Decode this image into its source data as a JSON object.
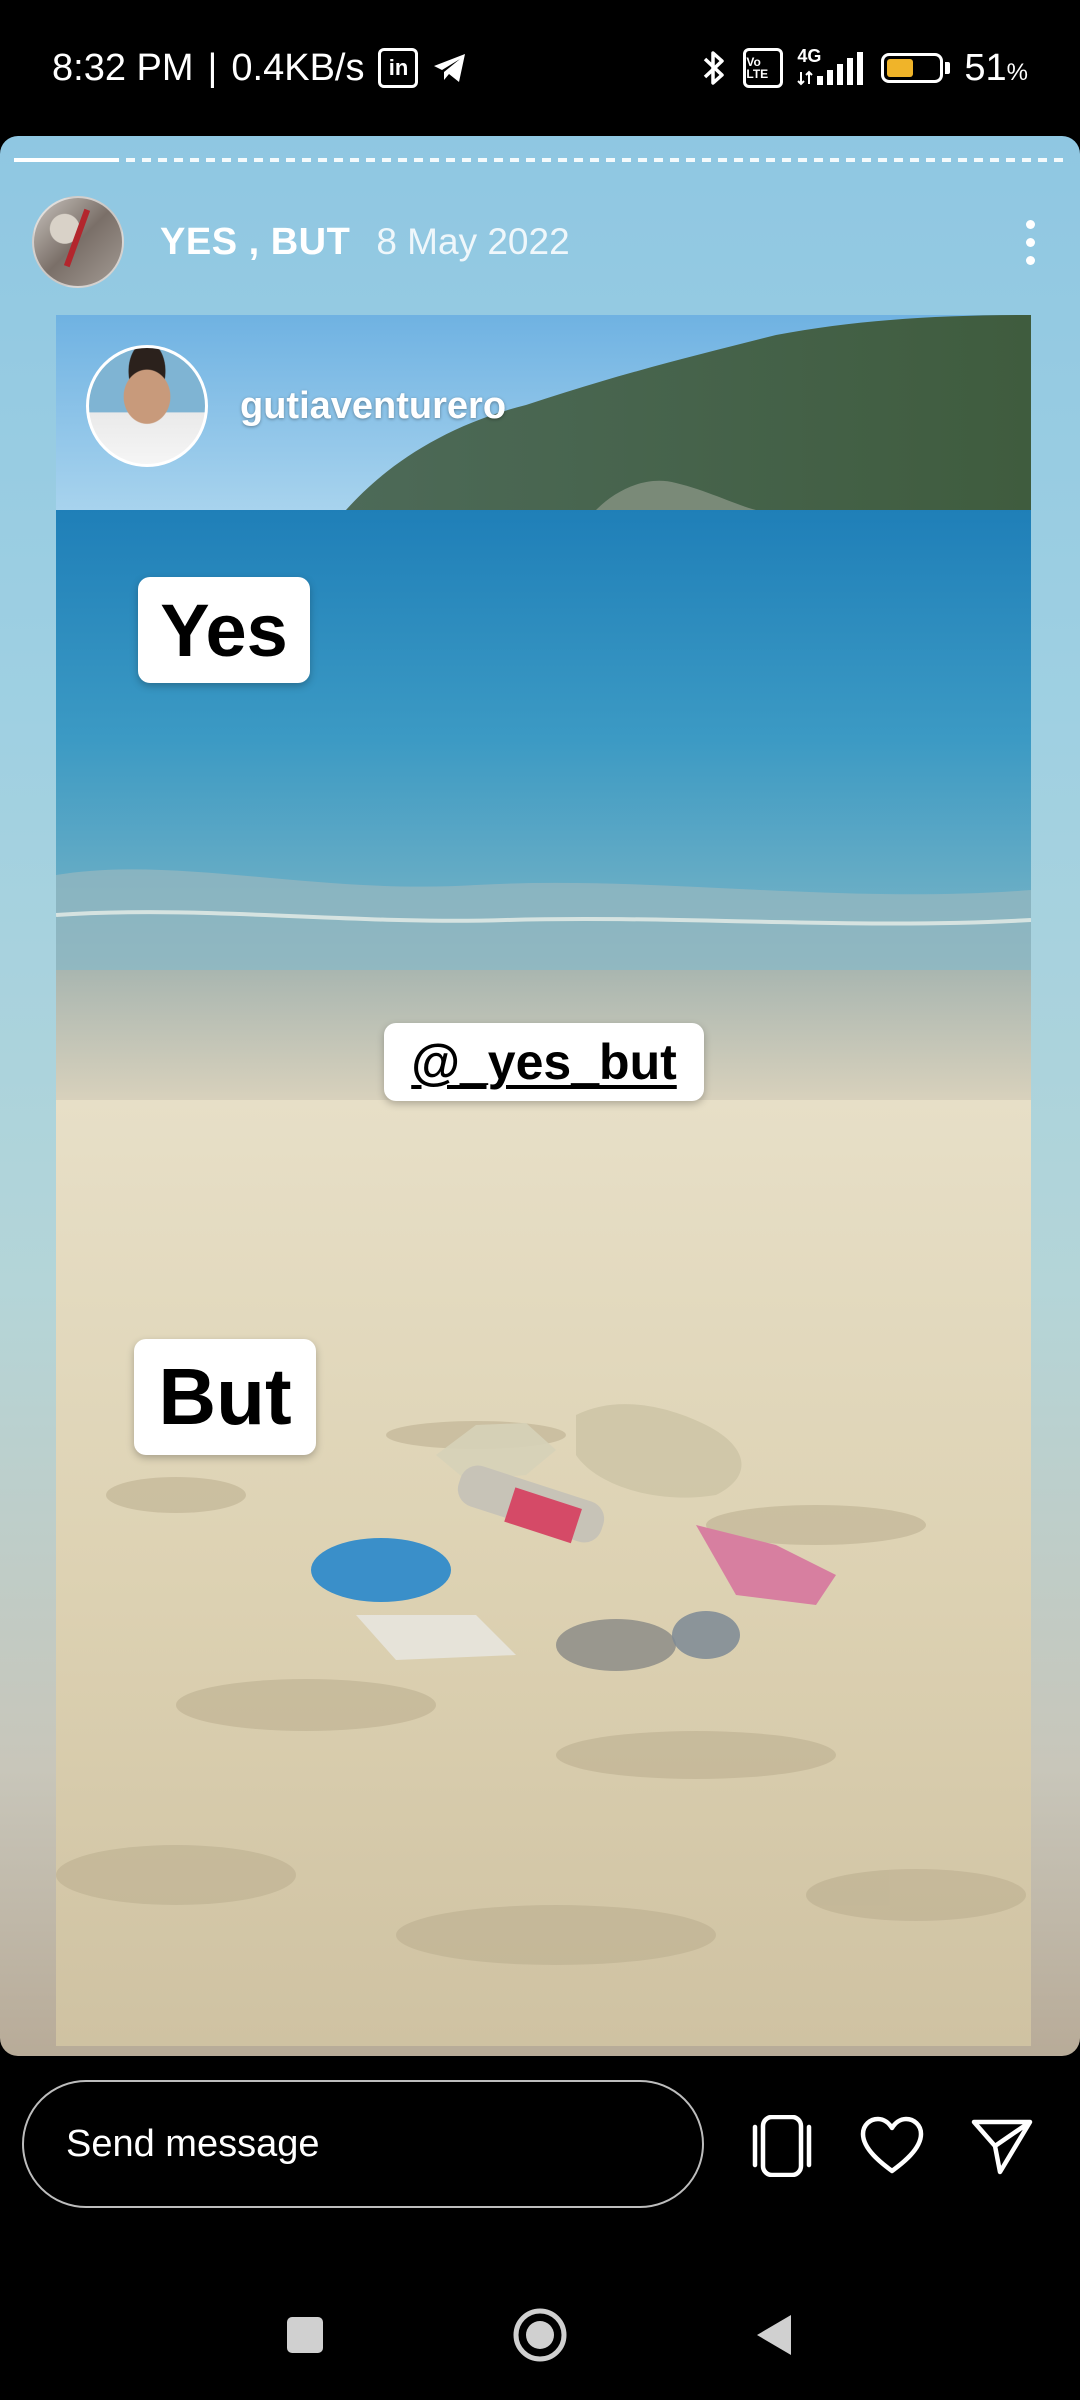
{
  "status_bar": {
    "time": "8:32 PM",
    "separator": "|",
    "speed": "0.4KB/s",
    "linkedin_label": "in",
    "volte_label": "Vo LTE",
    "network": "4G",
    "battery_percent": "51",
    "battery_unit": "%",
    "battery_level": 0.51
  },
  "story": {
    "title": "YES , BUT",
    "date": "8 May 2022",
    "progress": 0.1,
    "repost_username": "gutiaventurero",
    "stickers": {
      "yes": "Yes",
      "mention": "@_yes_but",
      "but": "But"
    }
  },
  "reply_bar": {
    "message_placeholder": "Send message"
  },
  "icons": {
    "more": "more-vertical-icon",
    "share_to": "phone-share-icon",
    "like": "heart-icon",
    "send": "send-icon",
    "nav_recents": "square-icon",
    "nav_home": "circle-icon",
    "nav_back": "triangle-back-icon"
  },
  "colors": {
    "battery_fill": "#f0b429",
    "sticker_bg": "#ffffff"
  }
}
